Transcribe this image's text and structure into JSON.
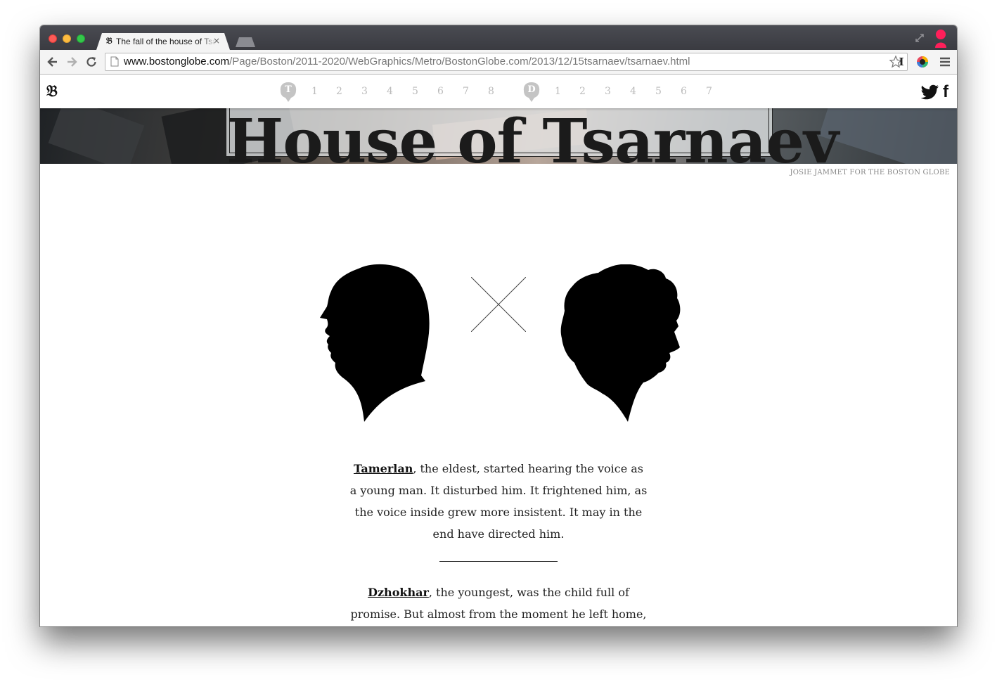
{
  "browser": {
    "tab_title": "The fall of the house of Tsarnaev",
    "tab_close": "×",
    "url_host": "www.bostonglobe.com",
    "url_path": "/Page/Boston/2011-2020/WebGraphics/Metro/BostonGlobe.com/2013/12/15tsarnaev/tsarnaev.html",
    "favicon": "𝔅",
    "ext_label": "I",
    "icons": [
      "back-arrow-icon",
      "forward-arrow-icon",
      "reload-icon",
      "star-icon",
      "menu-icon",
      "fullscreen-icon",
      "profile-icon"
    ]
  },
  "site": {
    "logo": "𝔅",
    "chapters": [
      {
        "badge": "T",
        "numbers": [
          "1",
          "2",
          "3",
          "4",
          "5",
          "6",
          "7",
          "8"
        ]
      },
      {
        "badge": "D",
        "numbers": [
          "1",
          "2",
          "3",
          "4",
          "5",
          "6",
          "7"
        ]
      }
    ],
    "social": {
      "facebook": "f"
    }
  },
  "hero": {
    "title": "House of Tsarnaev",
    "credit": "JOSIE JAMMET FOR THE BOSTON GLOBE"
  },
  "story": {
    "p1_name": "Tamerlan",
    "p1_text": ", the eldest, started hearing the voice as a young man. It disturbed him. It frightened him, as the voice inside grew more insistent. It may in the end have directed him.",
    "p2_name": "Dzhokhar",
    "p2_text": ", the youngest, was the child full of promise. But almost from the moment he left home, trouble and failure seemed to mark him, and risk to allure him. He"
  },
  "colors": {
    "badge_gray": "#c4c4c4",
    "text": "#222222",
    "close_red": "#fc5b57",
    "minimize_yellow": "#fdbc40",
    "zoom_green": "#34c84a"
  }
}
